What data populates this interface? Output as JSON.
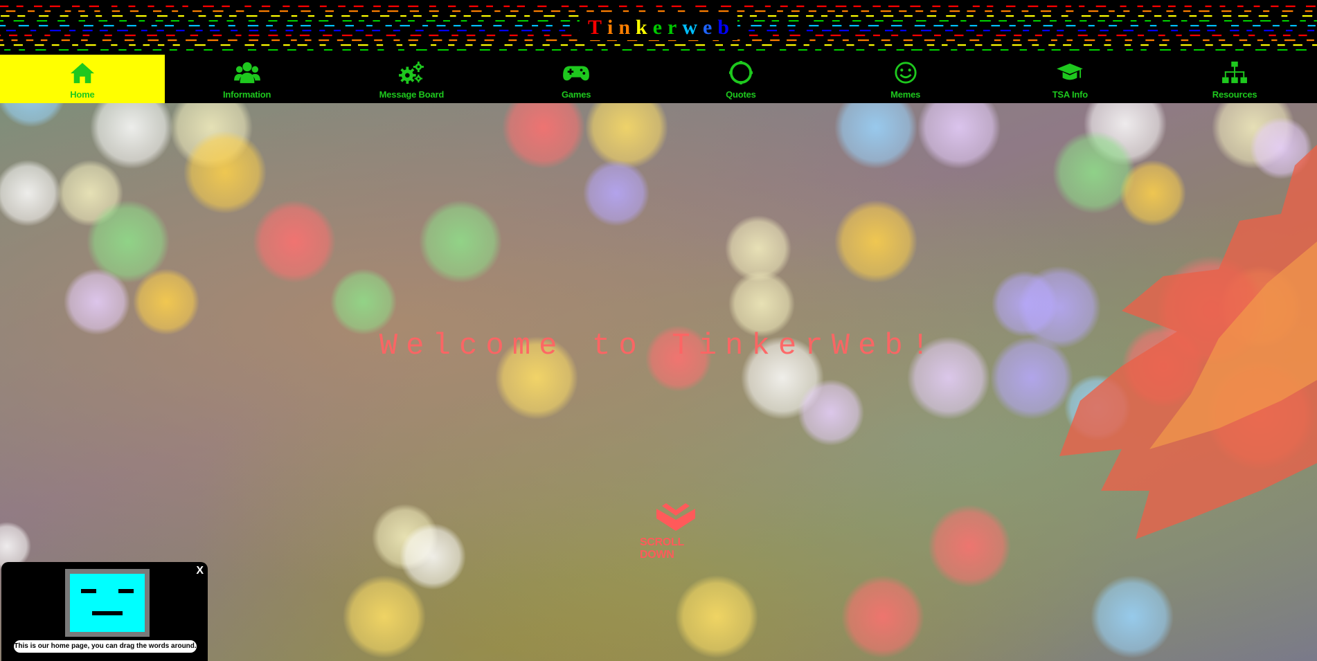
{
  "header": {
    "title_letters": [
      {
        "ch": "T",
        "color": "#ff0000"
      },
      {
        "ch": "i",
        "color": "#ff7f00"
      },
      {
        "ch": "n",
        "color": "#ff7f00"
      },
      {
        "ch": "k",
        "color": "#ffff00"
      },
      {
        "ch": "e",
        "color": "#00c800"
      },
      {
        "ch": "r",
        "color": "#00c800"
      },
      {
        "ch": "w",
        "color": "#00bfff"
      },
      {
        "ch": "e",
        "color": "#1e64ff"
      },
      {
        "ch": "b",
        "color": "#0000ff"
      }
    ],
    "stripe_colors": [
      "#ff0000",
      "#ff7f00",
      "#ffff00",
      "#00c800",
      "#00bfff",
      "#0000ff"
    ]
  },
  "nav": {
    "items": [
      {
        "label": "Home",
        "icon": "home-icon",
        "active": true
      },
      {
        "label": "Information",
        "icon": "users-icon",
        "active": false
      },
      {
        "label": "Message Board",
        "icon": "gears-icon",
        "active": false
      },
      {
        "label": "Games",
        "icon": "gamepad-icon",
        "active": false
      },
      {
        "label": "Quotes",
        "icon": "circle-icon",
        "active": false
      },
      {
        "label": "Memes",
        "icon": "smiley-icon",
        "active": false
      },
      {
        "label": "TSA Info",
        "icon": "graduation-cap-icon",
        "active": false
      },
      {
        "label": "Resources",
        "icon": "sitemap-icon",
        "active": false
      }
    ],
    "text_color": "#1ec81e",
    "active_bg": "#ffff00"
  },
  "hero": {
    "welcome_text": "Welcome to TinkerWeb!",
    "welcome_color": "#ff6464",
    "scroll_label": "SCROLL DOWN",
    "scroll_color": "#ff5a5a"
  },
  "helper": {
    "close_label": "X",
    "message": "This is our home page, you can drag the words around.",
    "face_color": "#00ffff"
  }
}
